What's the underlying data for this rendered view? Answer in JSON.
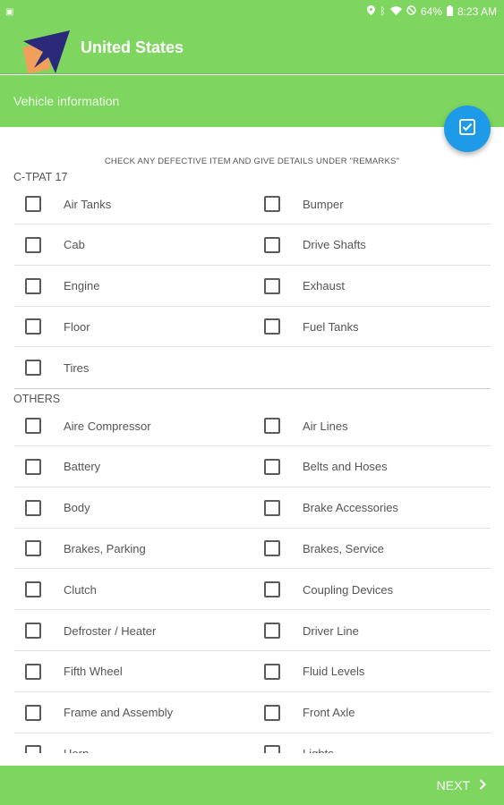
{
  "status_bar": {
    "battery": "64%",
    "time": "8:23 AM"
  },
  "app_bar": {
    "title": "United States"
  },
  "subheader": {
    "title": "Vehicle information"
  },
  "instruction": "CHECK ANY DEFECTIVE ITEM AND GIVE DETAILS UNDER \"REMARKS\"",
  "sections": {
    "ctpat": {
      "label": "C-TPAT 17",
      "items": [
        "Air Tanks",
        "Bumper",
        "Cab",
        "Drive Shafts",
        "Engine",
        "Exhaust",
        "Floor",
        "Fuel Tanks",
        "Tires"
      ]
    },
    "others": {
      "label": "OTHERS",
      "items": [
        "Aire Compressor",
        "Air Lines",
        "Battery",
        "Belts and Hoses",
        "Body",
        "Brake Accessories",
        "Brakes, Parking",
        "Brakes, Service",
        "Clutch",
        "Coupling Devices",
        "Defroster / Heater",
        "Driver Line",
        "Fifth Wheel",
        "Fluid Levels",
        "Frame and Assembly",
        "Front Axle",
        "Horn",
        "Lights"
      ]
    }
  },
  "footer": {
    "next_label": "NEXT"
  },
  "colors": {
    "primary": "#7ed55f",
    "fab": "#1e9be8",
    "logo_navy": "#2b2a7a",
    "logo_orange": "#f0a05a"
  },
  "icons": {
    "fab": "check-box-icon",
    "next": "chevron-right-icon"
  }
}
